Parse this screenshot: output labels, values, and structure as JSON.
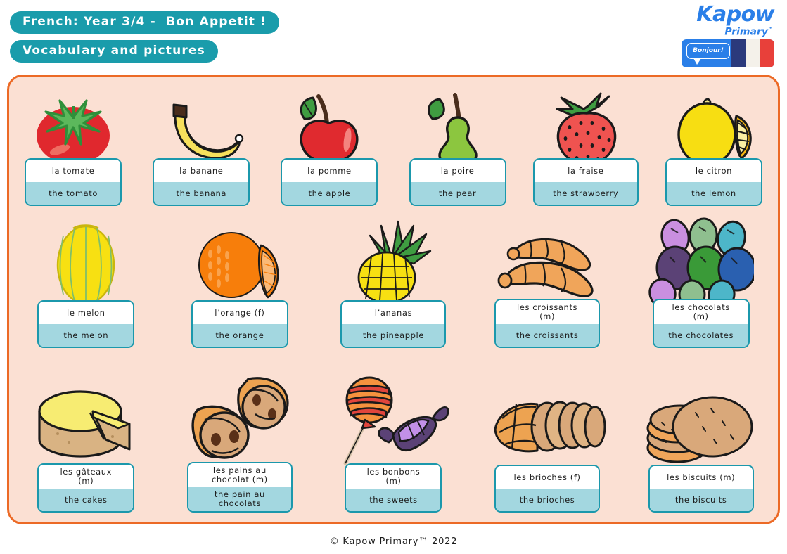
{
  "header": {
    "title_pill": "French: Year 3/4 -  Bon Appetit !",
    "subtitle_pill": "Vocabulary and pictures"
  },
  "logo": {
    "brand": "Kapow",
    "sub_brand": "Primary",
    "trademark": "™",
    "badge_bubble": "Bonjour!",
    "flag_name": "french-flag"
  },
  "colors": {
    "teal_pill": "#1a9cab",
    "card_border": "#1b98ac",
    "card_english_bg": "#a3d7e0",
    "card_french_bg": "#ffffff",
    "panel_bg": "#fbe0d3",
    "panel_border": "#ec6a26",
    "logo_blue": "#2a7fe8"
  },
  "rows": [
    {
      "cards": [
        {
          "icon": "tomato-illustration",
          "french": "la tomate",
          "english": "the tomato"
        },
        {
          "icon": "banana-illustration",
          "french": "la banane",
          "english": "the banana"
        },
        {
          "icon": "apple-illustration",
          "french": "la pomme",
          "english": "the apple"
        },
        {
          "icon": "pear-illustration",
          "french": "la poire",
          "english": "the pear"
        },
        {
          "icon": "strawberry-illustration",
          "french": "la fraise",
          "english": "the strawberry"
        },
        {
          "icon": "lemon-illustration",
          "french": "le citron",
          "english": "the lemon"
        }
      ]
    },
    {
      "cards": [
        {
          "icon": "melon-illustration",
          "french": "le melon",
          "english": "the melon"
        },
        {
          "icon": "orange-illustration",
          "french": "l’orange (f)",
          "english": "the orange"
        },
        {
          "icon": "pineapple-illustration",
          "french": "l’ananas",
          "english": "the pineapple"
        },
        {
          "icon": "croissants-illustration",
          "french": "les croissants\n(m)",
          "english": "the croissants"
        },
        {
          "icon": "chocolates-illustration",
          "french": "les chocolats\n(m)",
          "english": "the chocolates"
        }
      ]
    },
    {
      "cards": [
        {
          "icon": "cake-illustration",
          "french": "les gâteaux\n(m)",
          "english": "the cakes"
        },
        {
          "icon": "pain-au-chocolat-illustration",
          "french": "les pains au\nchocolat (m)",
          "english": "the pain au\nchocolats"
        },
        {
          "icon": "sweets-illustration",
          "french": "les bonbons\n(m)",
          "english": "the sweets"
        },
        {
          "icon": "brioches-illustration",
          "french": "les brioches (f)",
          "english": "the brioches"
        },
        {
          "icon": "biscuits-illustration",
          "french": "les biscuits (m)",
          "english": "the biscuits"
        }
      ]
    }
  ],
  "footer": {
    "copyright_symbol": "©",
    "text": "© Kapow Primary™ 2022"
  }
}
